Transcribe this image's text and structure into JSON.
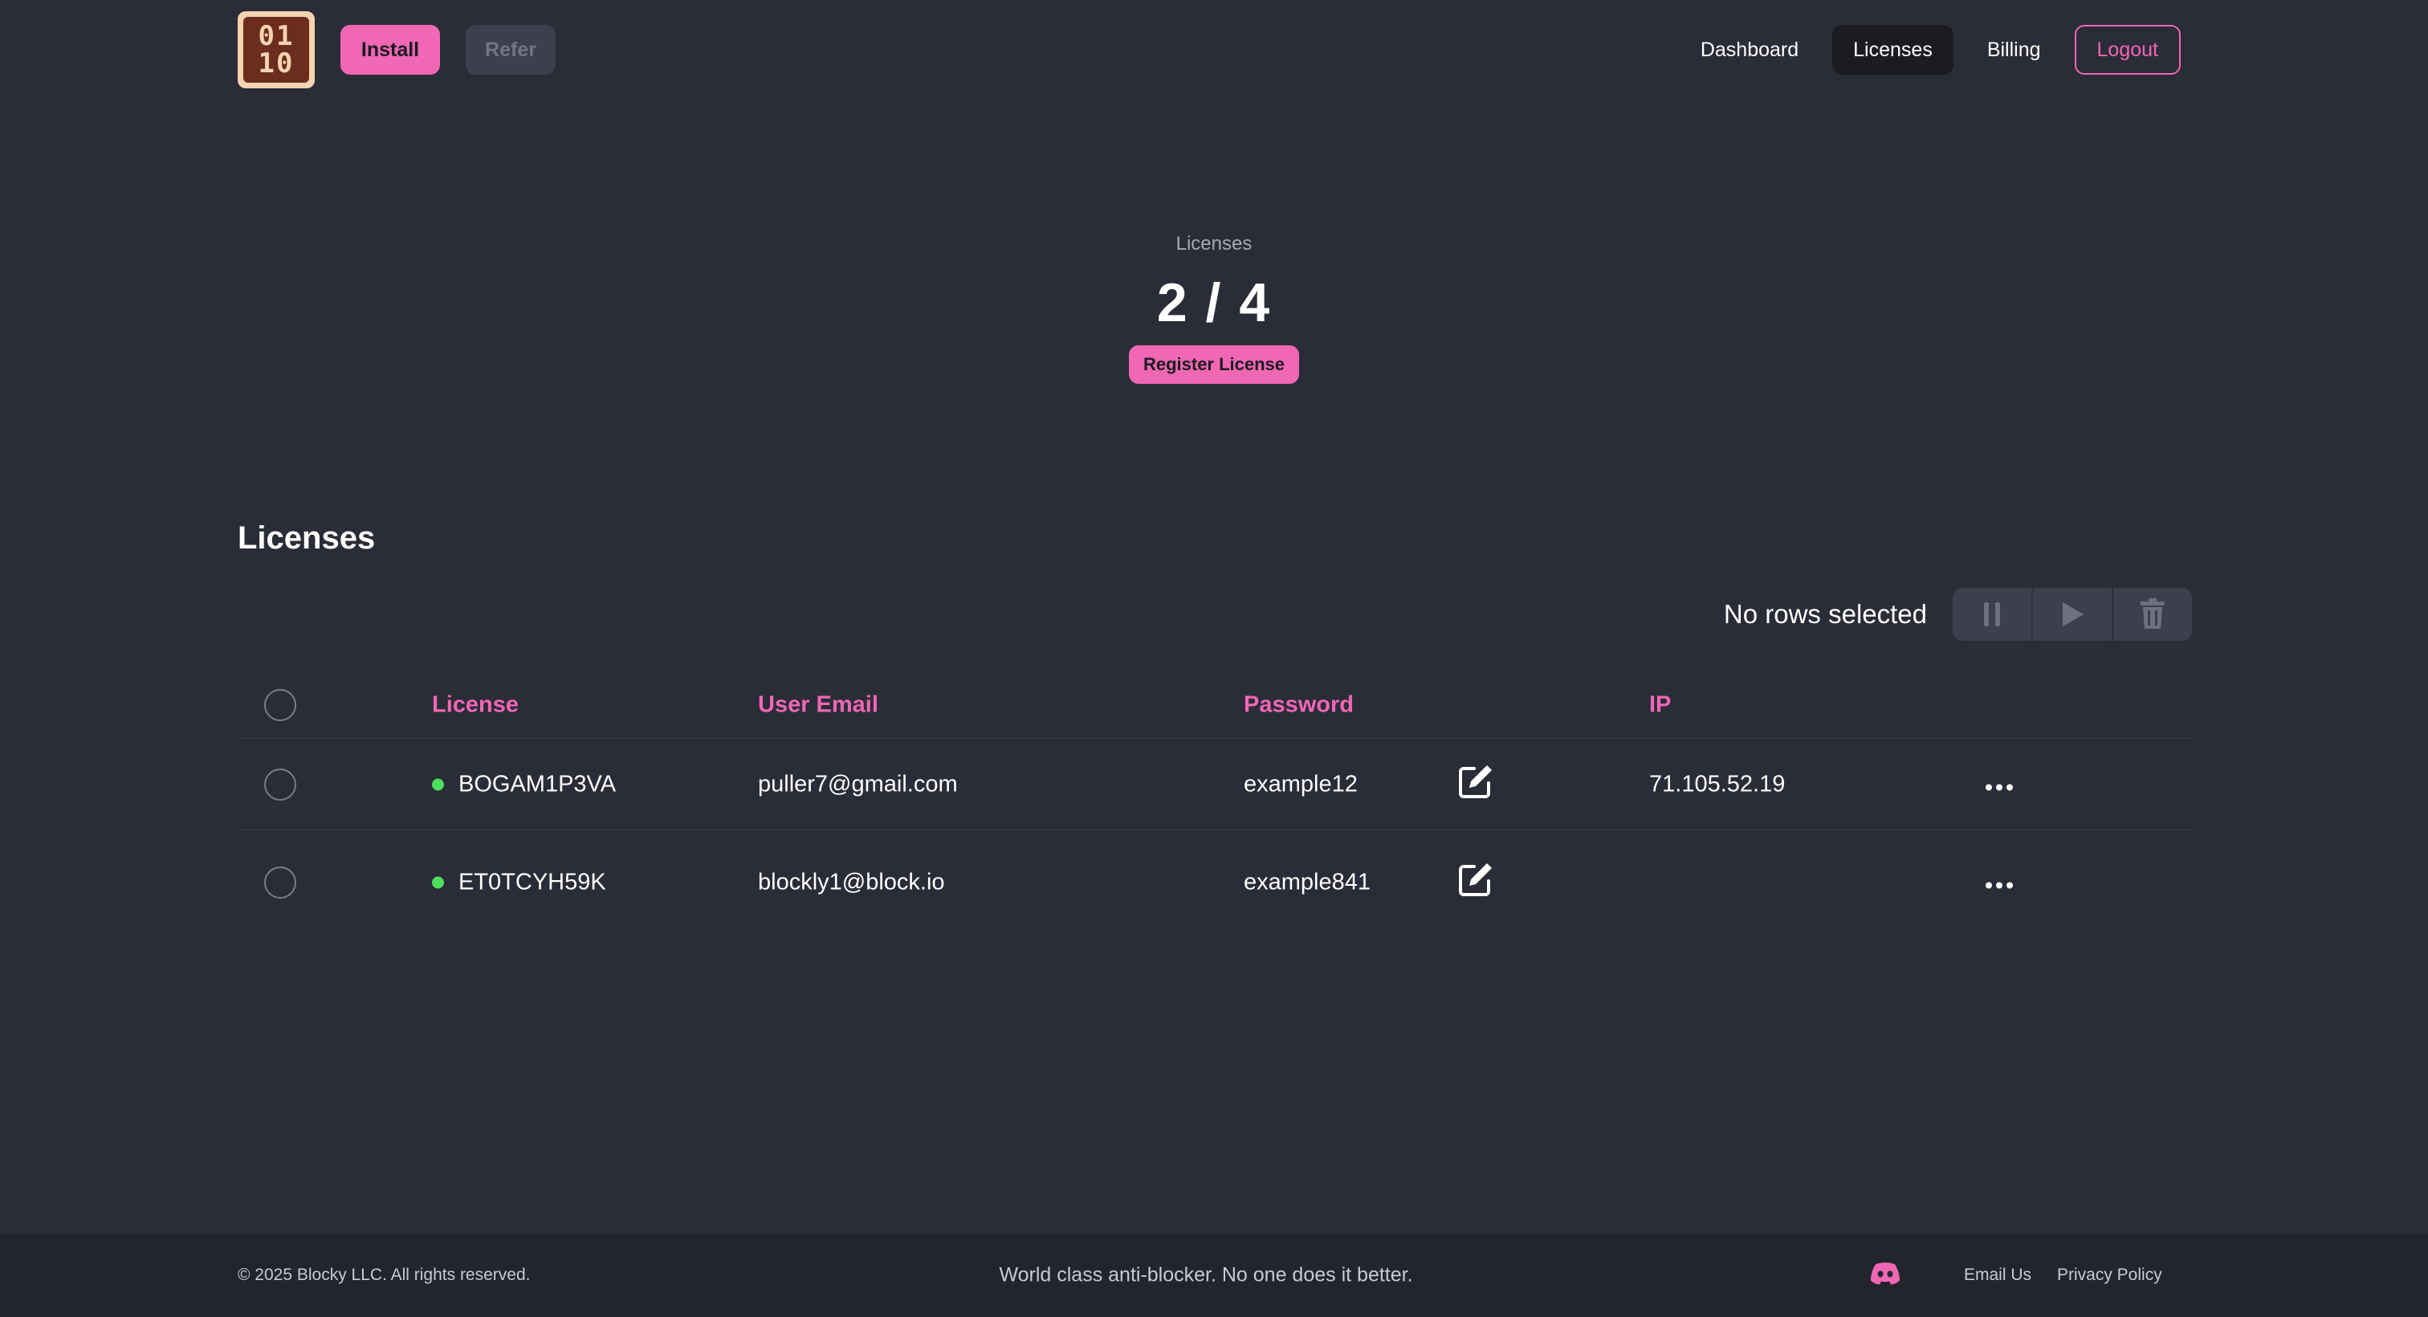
{
  "header": {
    "logo": {
      "line1": "01",
      "line2": "10"
    },
    "install_label": "Install",
    "refer_label": "Refer",
    "nav": [
      {
        "label": "Dashboard",
        "active": false
      },
      {
        "label": "Licenses",
        "active": true
      },
      {
        "label": "Billing",
        "active": false
      }
    ],
    "logout_label": "Logout"
  },
  "stats": {
    "label": "Licenses",
    "value": "2 / 4",
    "register_label": "Register License"
  },
  "section": {
    "title": "Licenses"
  },
  "toolbar": {
    "selection_text": "No rows selected",
    "actions": [
      "pause-icon",
      "play-icon",
      "trash-icon"
    ]
  },
  "table": {
    "columns": [
      "License",
      "User Email",
      "Password",
      "IP"
    ],
    "rows": [
      {
        "license": "BOGAM1P3VA",
        "email": "puller7@gmail.com",
        "password": "example12",
        "ip": "71.105.52.19",
        "status_color": "#4be05d"
      },
      {
        "license": "ET0TCYH59K",
        "email": "blockly1@block.io",
        "password": "example841",
        "ip": "",
        "status_color": "#4be05d"
      }
    ]
  },
  "footer": {
    "copyright": "© 2025 Blocky LLC. All rights reserved.",
    "tagline": "World class anti-blocker. No one does it better.",
    "email_label": "Email Us",
    "privacy_label": "Privacy Policy"
  },
  "colors": {
    "accent": "#f067b4",
    "background": "#2a2c37",
    "status_active": "#4be05d"
  }
}
